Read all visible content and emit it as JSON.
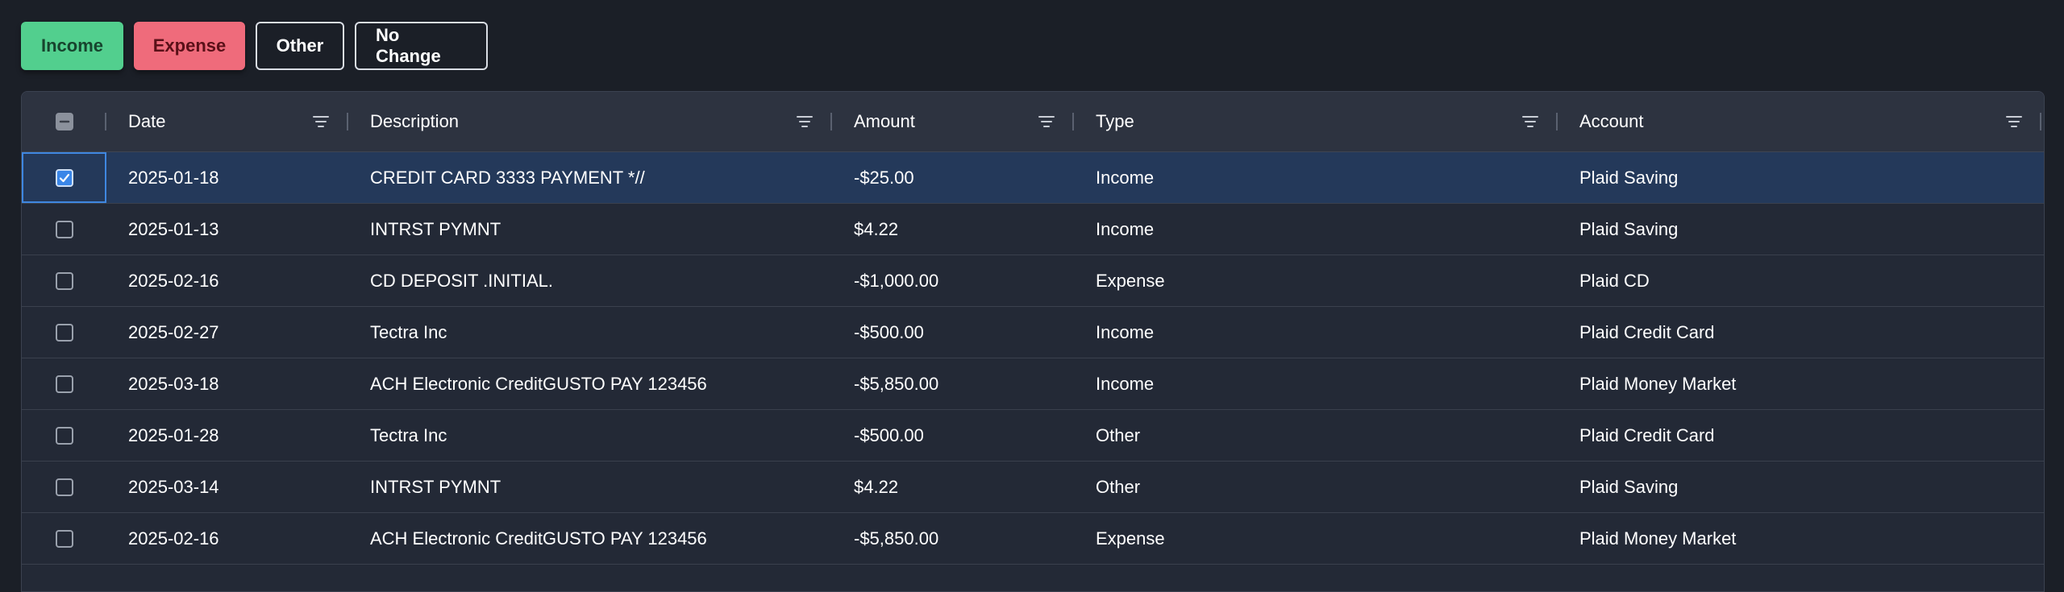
{
  "toolbar": {
    "income_label": "Income",
    "expense_label": "Expense",
    "other_label": "Other",
    "no_change_label": "No Change"
  },
  "colors": {
    "income": "#52cf8e",
    "expense": "#ef6b7b",
    "selected_row": "#24395a",
    "accent": "#3a86e8"
  },
  "grid": {
    "columns": [
      {
        "label": "Date"
      },
      {
        "label": "Description"
      },
      {
        "label": "Amount"
      },
      {
        "label": "Type"
      },
      {
        "label": "Account"
      }
    ],
    "header_checkbox_state": "indeterminate",
    "rows": [
      {
        "checked": true,
        "date": "2025-01-18",
        "description": "CREDIT CARD 3333 PAYMENT *//",
        "amount": "-$25.00",
        "type": "Income",
        "account": "Plaid Saving"
      },
      {
        "checked": false,
        "date": "2025-01-13",
        "description": "INTRST PYMNT",
        "amount": "$4.22",
        "type": "Income",
        "account": "Plaid Saving"
      },
      {
        "checked": false,
        "date": "2025-02-16",
        "description": "CD DEPOSIT .INITIAL.",
        "amount": "-$1,000.00",
        "type": "Expense",
        "account": "Plaid CD"
      },
      {
        "checked": false,
        "date": "2025-02-27",
        "description": "Tectra Inc",
        "amount": "-$500.00",
        "type": "Income",
        "account": "Plaid Credit Card"
      },
      {
        "checked": false,
        "date": "2025-03-18",
        "description": "ACH Electronic CreditGUSTO PAY 123456",
        "amount": "-$5,850.00",
        "type": "Income",
        "account": "Plaid Money Market"
      },
      {
        "checked": false,
        "date": "2025-01-28",
        "description": "Tectra Inc",
        "amount": "-$500.00",
        "type": "Other",
        "account": "Plaid Credit Card"
      },
      {
        "checked": false,
        "date": "2025-03-14",
        "description": "INTRST PYMNT",
        "amount": "$4.22",
        "type": "Other",
        "account": "Plaid Saving"
      },
      {
        "checked": false,
        "date": "2025-02-16",
        "description": "ACH Electronic CreditGUSTO PAY 123456",
        "amount": "-$5,850.00",
        "type": "Expense",
        "account": "Plaid Money Market"
      }
    ]
  }
}
